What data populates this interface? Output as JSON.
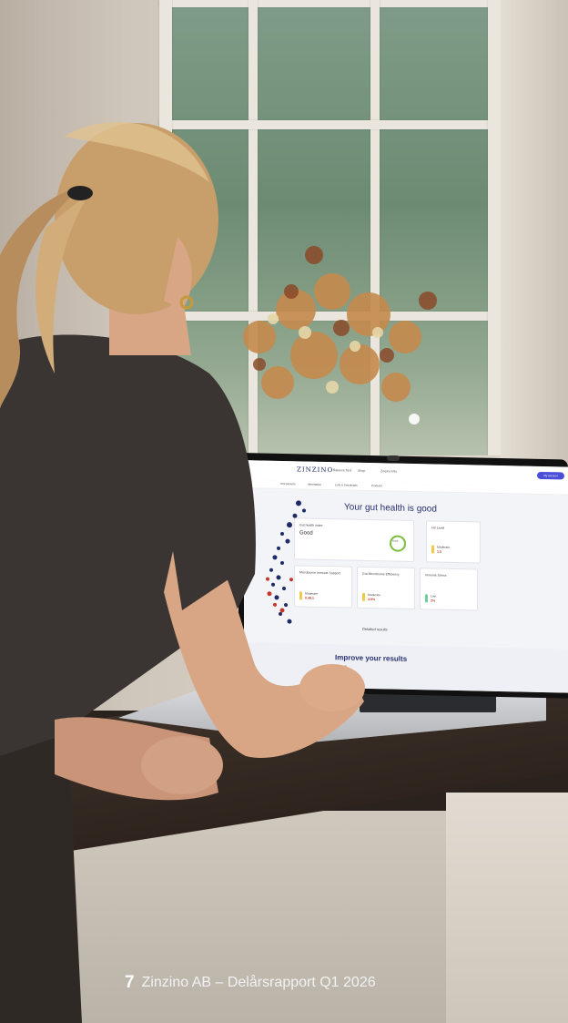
{
  "screen": {
    "brand": "ZINZINO",
    "nav": [
      "Balance Test",
      "Shop",
      "Zinzino Info"
    ],
    "subnav": [
      "Test Results",
      "Information",
      "Lists & Downloads",
      "Products"
    ],
    "account_button": "My account",
    "headline": "Your gut health is good",
    "cards": [
      {
        "label": "Gut health index",
        "value": "Good"
      },
      {
        "label": "HS Level",
        "level": "Moderate",
        "number": "1.5"
      },
      {
        "label": "Microbiome immune Support",
        "level": "Moderate",
        "number": "0.48.1"
      },
      {
        "label": "Gut Microbiome Efficiency",
        "level": "Moderate",
        "number": "4.9%"
      },
      {
        "label": "Immune Stress",
        "level": "Low",
        "number": "2%"
      }
    ],
    "gauge_label": "Good",
    "detailed_results": "Detailed results",
    "improve_title": "Improve your results"
  },
  "footer": {
    "page_number": "7",
    "text": "Zinzino AB – Delårsrapport Q1 2026"
  }
}
